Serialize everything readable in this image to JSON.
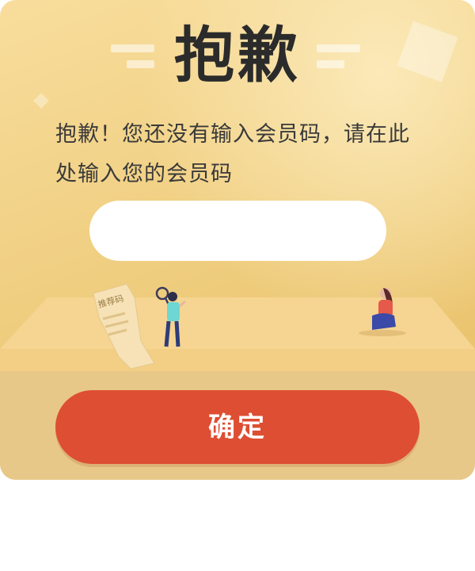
{
  "dialog": {
    "title": "抱歉",
    "message": "抱歉！您还没有输入会员码，请在此处输入您的会员码",
    "input": {
      "value": "",
      "placeholder": ""
    },
    "confirm_label": "确定"
  },
  "illustration": {
    "paper_label": "推荐码",
    "icons": [
      "recommend-code-paper-icon",
      "person-with-magnifier-icon",
      "sitting-person-icon"
    ]
  },
  "colors": {
    "card_gradient_start": "#f8dd9c",
    "card_gradient_end": "#e7bd63",
    "stage": "#f5d591",
    "bottom_band": "#e8c888",
    "confirm_button": "#de4e32",
    "title_text": "#2b2b2b"
  }
}
